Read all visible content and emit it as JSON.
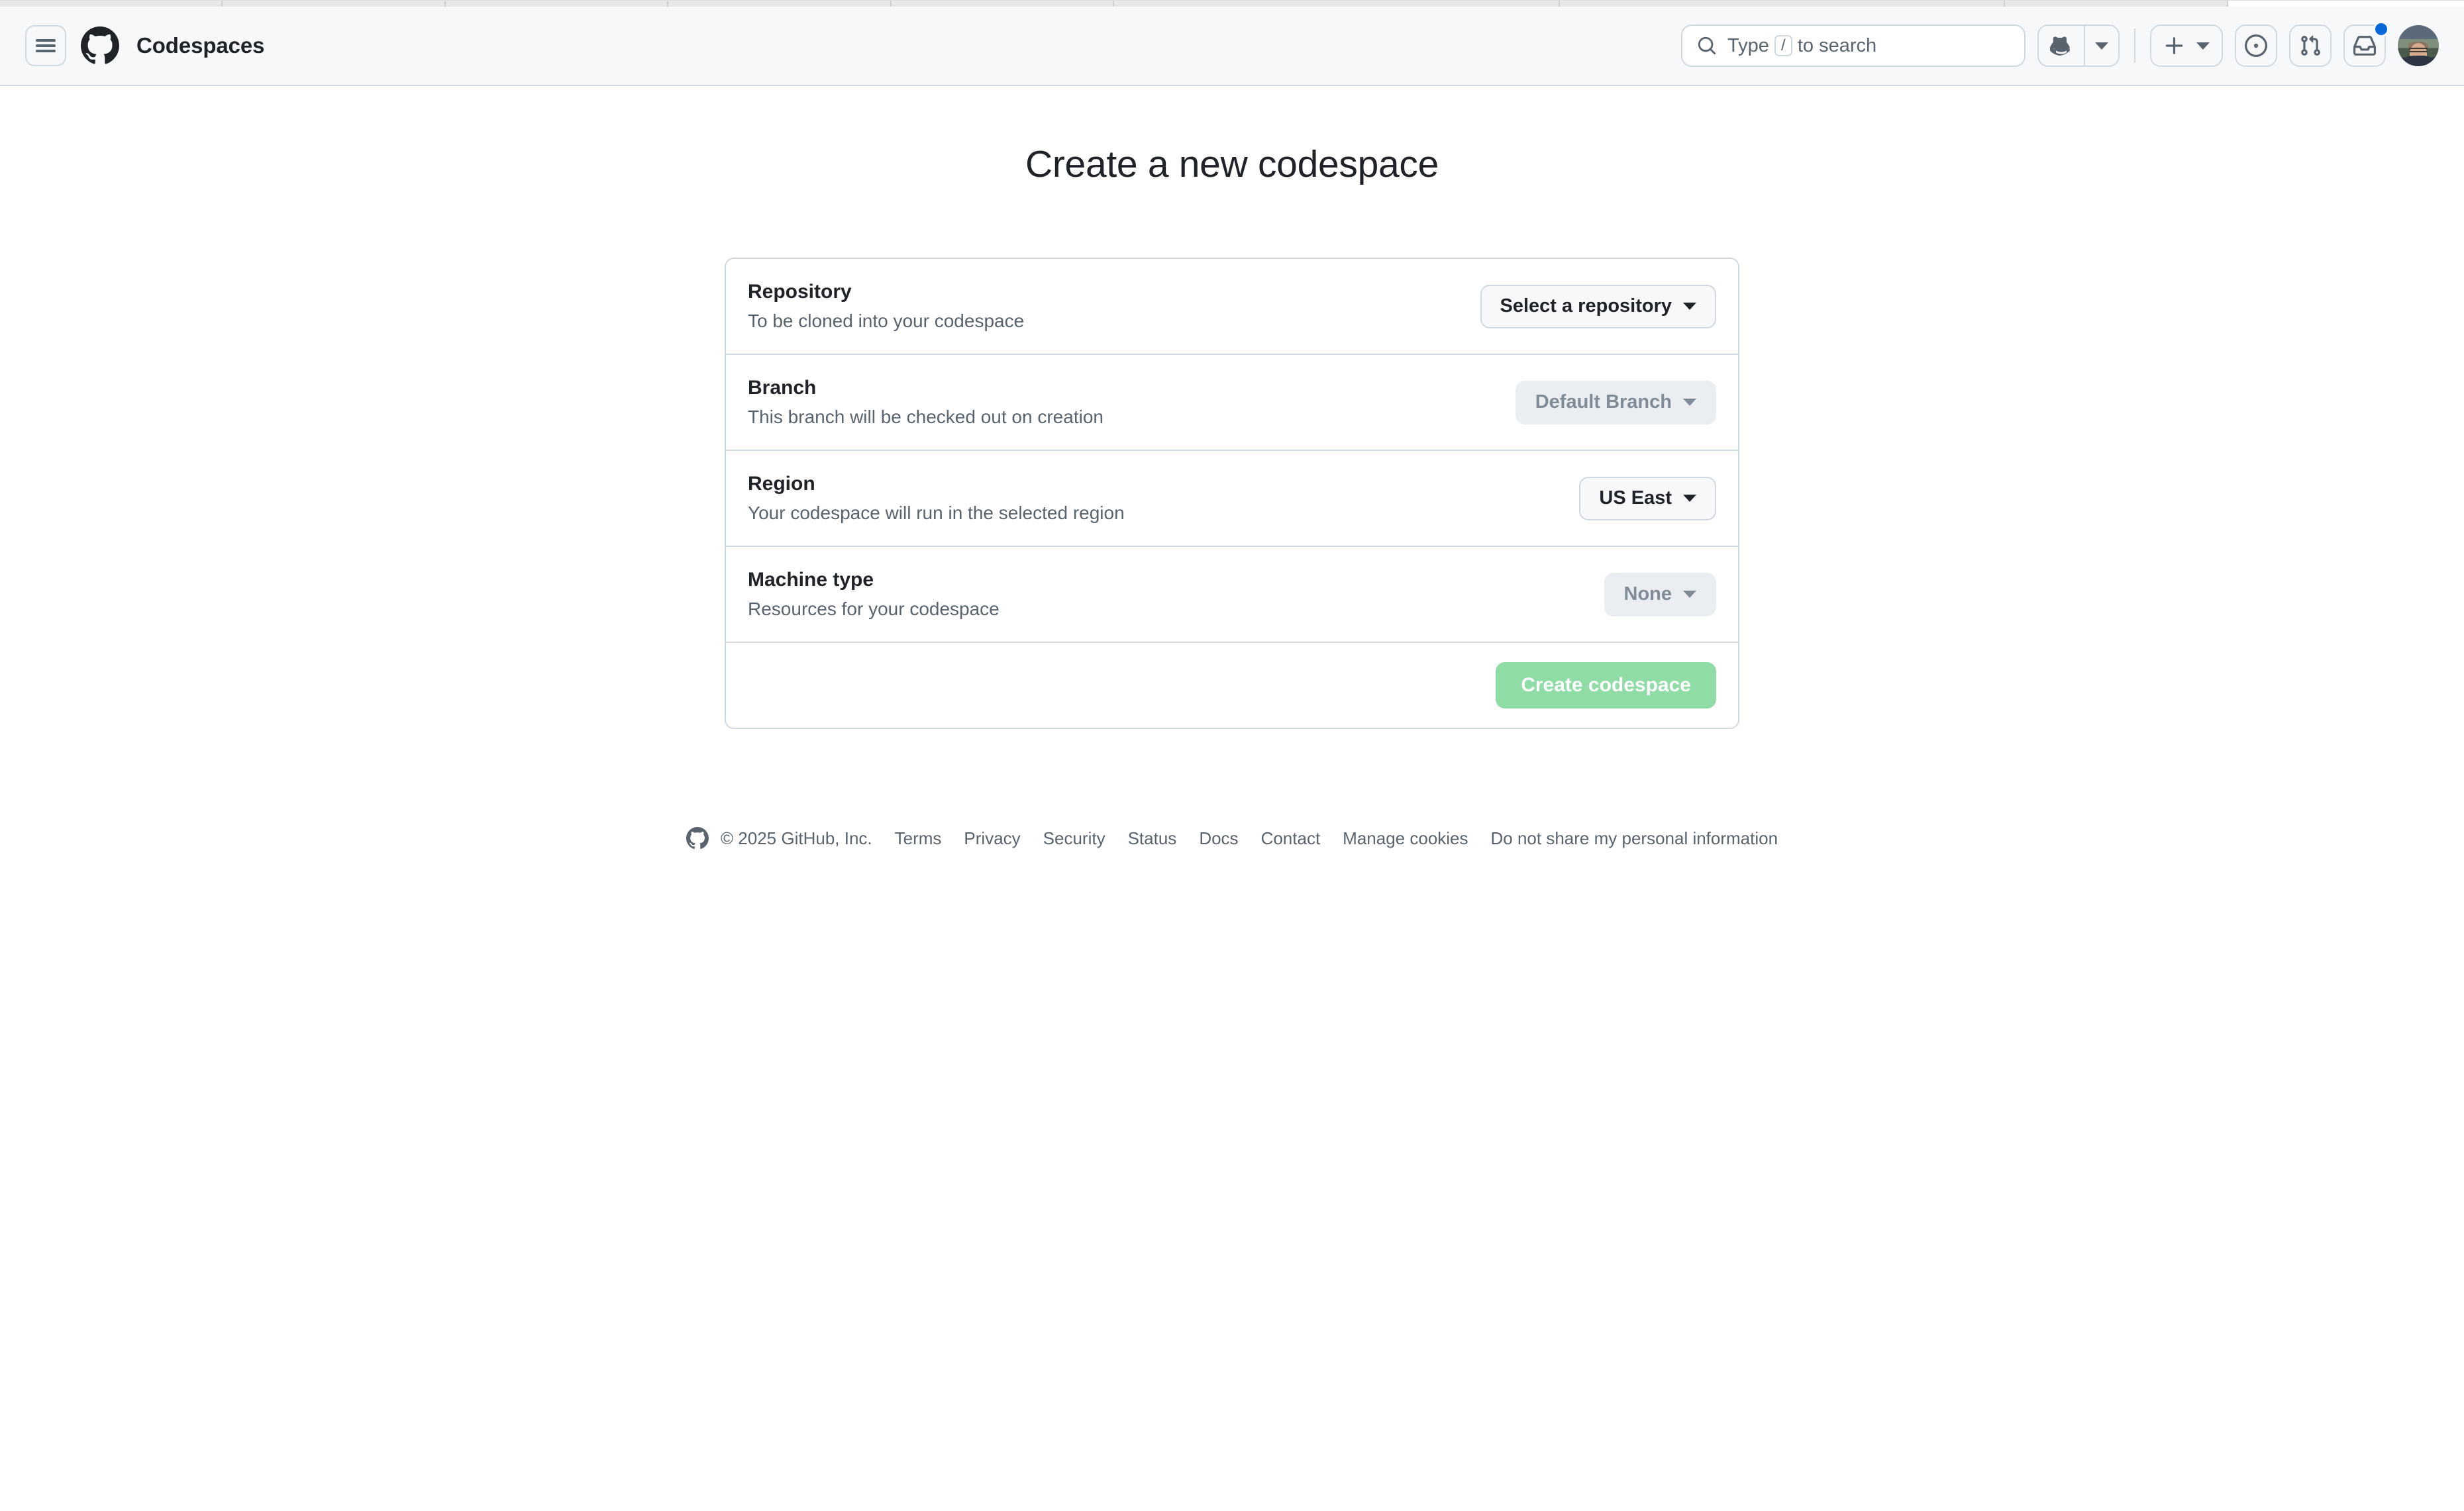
{
  "header": {
    "menu_icon": "hamburger-icon",
    "logo_icon": "github-mark-icon",
    "app_name": "Codespaces",
    "search": {
      "icon": "search-icon",
      "prefix": "Type",
      "key_hint": "/",
      "suffix": "to search"
    },
    "copilot_icon": "copilot-icon",
    "copilot_dropdown_icon": "triangle-down-icon",
    "create_new_icon": "plus-icon",
    "create_new_dropdown_icon": "triangle-down-icon",
    "issues_icon": "issue-opened-icon",
    "pull_requests_icon": "git-pull-request-icon",
    "notifications_icon": "inbox-icon",
    "notifications_has_unread": true,
    "avatar_icon": "user-avatar"
  },
  "main": {
    "title": "Create a new codespace",
    "rows": [
      {
        "title": "Repository",
        "description": "To be cloned into your codespace",
        "control_label": "Select a repository",
        "control_state": "enabled",
        "control_name": "repository-select-button"
      },
      {
        "title": "Branch",
        "description": "This branch will be checked out on creation",
        "control_label": "Default Branch",
        "control_state": "disabled",
        "control_name": "branch-select-button"
      },
      {
        "title": "Region",
        "description": "Your codespace will run in the selected region",
        "control_label": "US East",
        "control_state": "enabled",
        "control_name": "region-select-button"
      },
      {
        "title": "Machine type",
        "description": "Resources for your codespace",
        "control_label": "None",
        "control_state": "disabled",
        "control_name": "machine-type-select-button"
      }
    ],
    "submit_label": "Create codespace",
    "submit_state": "disabled"
  },
  "footer": {
    "mark_icon": "github-mark-icon",
    "copyright": "© 2025 GitHub, Inc.",
    "links": [
      "Terms",
      "Privacy",
      "Security",
      "Status",
      "Docs",
      "Contact",
      "Manage cookies",
      "Do not share my personal information"
    ]
  },
  "colors": {
    "header_bg": "#f6f8fa",
    "border": "#d1d9e0",
    "text_primary": "#1f2328",
    "text_muted": "#59636e",
    "accent_blue": "#0969da",
    "submit_green_disabled": "#8fdca6"
  }
}
